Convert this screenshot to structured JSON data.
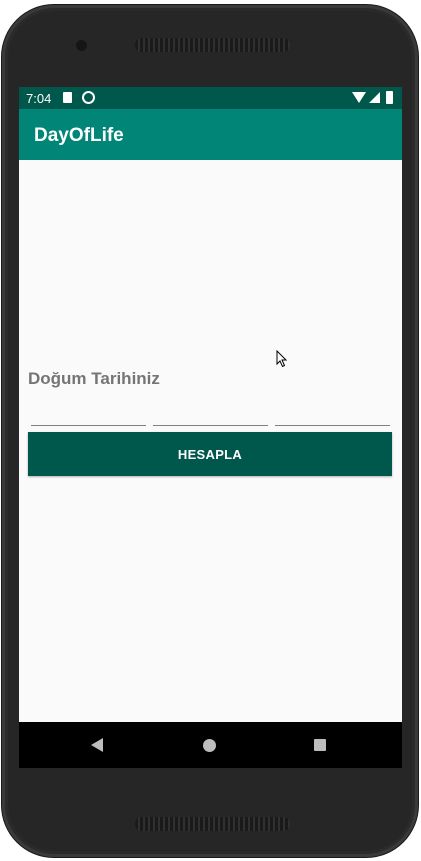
{
  "status_bar": {
    "time": "7:04",
    "icons": [
      "sd-card-icon",
      "sync-icon",
      "wifi-icon",
      "signal-icon",
      "battery-icon"
    ]
  },
  "app_bar": {
    "title": "DayOfLife",
    "color": "#008577"
  },
  "form": {
    "label": "Doğum Tarihiniz",
    "fields": [
      {
        "value": "",
        "placeholder": ""
      },
      {
        "value": "",
        "placeholder": ""
      },
      {
        "value": "",
        "placeholder": ""
      }
    ],
    "button_label": "HESAPLA",
    "button_color": "#00574b"
  },
  "nav_bar": {
    "icons": [
      "back-icon",
      "home-icon",
      "recents-icon"
    ]
  }
}
